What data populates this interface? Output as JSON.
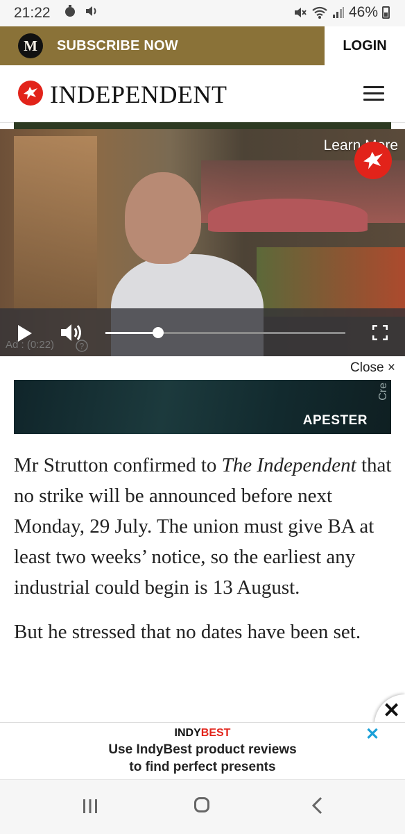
{
  "status_bar": {
    "time": "21:22",
    "battery": "46%"
  },
  "subscribe_bar": {
    "logo_letter": "M",
    "subscribe_label": "SUBSCRIBE NOW",
    "login_label": "LOGIN"
  },
  "header": {
    "brand": "INDEPENDENT"
  },
  "video": {
    "learn_more": "Learn More",
    "ad_label": "Ad : (0:22)",
    "progress_fraction": 0.22
  },
  "close_row": {
    "label": "Close ×"
  },
  "apester": {
    "logo": "APESTER",
    "credit": "Cre"
  },
  "article": {
    "para1": {
      "before": "Mr Strutton confirmed to ",
      "italic": "The Independent",
      "after": " that no strike will be announced before next Monday, 29 July. The union must give BA at least two weeks’ notice, so the earliest any industrial could begin is 13 August."
    },
    "para2": "But he stressed that no dates have been set."
  },
  "bottom_ad": {
    "brand_part1": "INDY",
    "brand_part2": "BEST",
    "line1": "Use IndyBest product reviews",
    "line2": "to find perfect presents",
    "close": "✕"
  },
  "colors": {
    "gold": "#8a7238",
    "brand_red": "#e2231a",
    "ad_close_blue": "#1aa0d8"
  },
  "icons": [
    "timer-icon",
    "volume-icon",
    "mute-icon",
    "wifi-icon",
    "signal-icon",
    "battery-icon",
    "eagle-icon",
    "menu-icon",
    "play-icon",
    "fullscreen-icon",
    "help-icon",
    "close-icon",
    "recent-apps-icon",
    "home-icon",
    "back-icon"
  ]
}
